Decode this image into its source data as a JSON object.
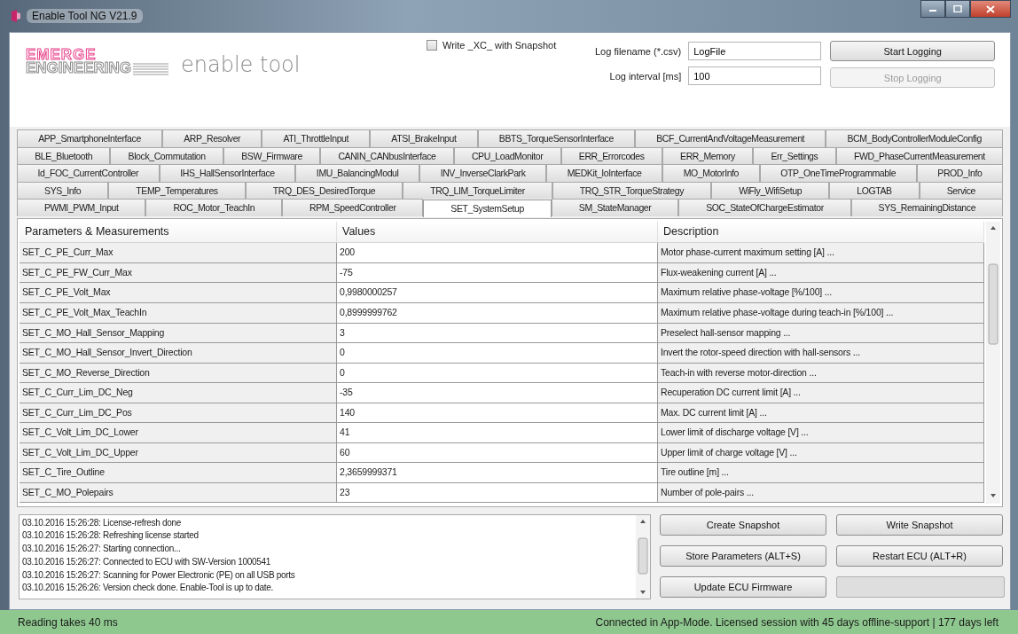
{
  "window": {
    "title": "Enable Tool NG V21.9"
  },
  "logo": {
    "line_1": "EMERGE",
    "line_2": "ENGINEERING",
    "product": "enable tool"
  },
  "snapshot_option": {
    "label": "Write _XC_ with Snapshot",
    "checked": false
  },
  "log_settings": [
    {
      "label": "Log filename (*.csv)",
      "value": "LogFile"
    },
    {
      "label": "Log interval [ms]",
      "value": "100"
    }
  ],
  "logging_buttons": [
    {
      "label": "Start Logging",
      "disabled": false
    },
    {
      "label": "Stop Logging",
      "disabled": true
    }
  ],
  "tab_rows": [
    [
      {
        "label": "APP_SmartphoneInterface",
        "selected": false
      },
      {
        "label": "ARP_Resolver",
        "selected": false
      },
      {
        "label": "ATI_ThrottleInput",
        "selected": false
      },
      {
        "label": "ATSI_BrakeInput",
        "selected": false
      },
      {
        "label": "BBTS_TorqueSensorInterface",
        "selected": false
      },
      {
        "label": "BCF_CurrentAndVoltageMeasurement",
        "selected": false
      },
      {
        "label": "BCM_BodyControllerModuleConfig",
        "selected": false
      }
    ],
    [
      {
        "label": "BLE_Bluetooth",
        "selected": false
      },
      {
        "label": "Block_Commutation",
        "selected": false
      },
      {
        "label": "BSW_Firmware",
        "selected": false
      },
      {
        "label": "CANIN_CANbusInterface",
        "selected": false
      },
      {
        "label": "CPU_LoadMonitor",
        "selected": false
      },
      {
        "label": "ERR_Errorcodes",
        "selected": false
      },
      {
        "label": "ERR_Memory",
        "selected": false
      },
      {
        "label": "Err_Settings",
        "selected": false
      },
      {
        "label": "FWD_PhaseCurrentMeasurement",
        "selected": false
      }
    ],
    [
      {
        "label": "Id_FOC_CurrentController",
        "selected": false
      },
      {
        "label": "IHS_HallSensorInterface",
        "selected": false
      },
      {
        "label": "IMU_BalancingModul",
        "selected": false
      },
      {
        "label": "INV_InverseClarkPark",
        "selected": false
      },
      {
        "label": "MEDKit_IoInterface",
        "selected": false
      },
      {
        "label": "MO_MotorInfo",
        "selected": false
      },
      {
        "label": "OTP_OneTimeProgrammable",
        "selected": false
      },
      {
        "label": "PROD_Info",
        "selected": false
      }
    ],
    [
      {
        "label": "SYS_Info",
        "selected": false
      },
      {
        "label": "TEMP_Temperatures",
        "selected": false
      },
      {
        "label": "TRQ_DES_DesiredTorque",
        "selected": false
      },
      {
        "label": "TRQ_LIM_TorqueLimiter",
        "selected": false
      },
      {
        "label": "TRQ_STR_TorqueStrategy",
        "selected": false
      },
      {
        "label": "WiFly_WifiSetup",
        "selected": false
      },
      {
        "label": "LOGTAB",
        "selected": false
      },
      {
        "label": "Service",
        "selected": false
      }
    ],
    [
      {
        "label": "PWMI_PWM_Input",
        "selected": false
      },
      {
        "label": "ROC_Motor_TeachIn",
        "selected": false
      },
      {
        "label": "RPM_SpeedController",
        "selected": false
      },
      {
        "label": "SET_SystemSetup",
        "selected": true
      },
      {
        "label": "SM_StateManager",
        "selected": false
      },
      {
        "label": "SOC_StateOfChargeEstimator",
        "selected": false
      },
      {
        "label": "SYS_RemainingDistance",
        "selected": false
      }
    ]
  ],
  "table": {
    "columns": [
      "Parameters & Measurements",
      "Values",
      "Description"
    ],
    "rows": [
      [
        "SET_C_PE_Curr_Max",
        "200",
        "Motor phase-current maximum setting [A] ..."
      ],
      [
        "SET_C_PE_FW_Curr_Max",
        "-75",
        "Flux-weakening current [A] ..."
      ],
      [
        "SET_C_PE_Volt_Max",
        "0,9980000257",
        "Maximum relative phase-voltage [%/100] ..."
      ],
      [
        "SET_C_PE_Volt_Max_TeachIn",
        "0,8999999762",
        "Maximum relative phase-voltage during teach-in [%/100] ..."
      ],
      [
        "SET_C_MO_Hall_Sensor_Mapping",
        "3",
        "Preselect hall-sensor mapping ..."
      ],
      [
        "SET_C_MO_Hall_Sensor_Invert_Direction",
        "0",
        "Invert the rotor-speed direction with hall-sensors ..."
      ],
      [
        "SET_C_MO_Reverse_Direction",
        "0",
        "Teach-in with reverse motor-direction ..."
      ],
      [
        "SET_C_Curr_Lim_DC_Neg",
        "-35",
        "Recuperation DC current limit [A] ..."
      ],
      [
        "SET_C_Curr_Lim_DC_Pos",
        "140",
        "Max. DC current limit [A] ..."
      ],
      [
        "SET_C_Volt_Lim_DC_Lower",
        "41",
        "Lower limit of discharge voltage [V] ..."
      ],
      [
        "SET_C_Volt_Lim_DC_Upper",
        "60",
        "Upper limit of charge voltage [V] ..."
      ],
      [
        "SET_C_Tire_Outline",
        "2,3659999371",
        "Tire outline [m] ..."
      ],
      [
        "SET_C_MO_Polepairs",
        "23",
        "Number of pole-pairs ..."
      ]
    ]
  },
  "log": [
    "03.10.2016 15:26:28: License-refresh done",
    "03.10.2016 15:26:28: Refreshing license started",
    "03.10.2016 15:26:27: Starting connection...",
    "03.10.2016 15:26:27: Connected to ECU with SW-Version 1000541",
    "03.10.2016 15:26:27: Scanning for Power Electronic (PE) on all USB ports",
    "03.10.2016 15:26:26: Version check done. Enable-Tool is up to date."
  ],
  "action_buttons": [
    "Create Snapshot",
    "Write Snapshot",
    "Store Parameters (ALT+S)",
    "Restart ECU (ALT+R)",
    "Update ECU Firmware"
  ],
  "status_bar": {
    "left": "Reading takes 40 ms",
    "right": "Connected in App-Mode.  Licensed session with 45 days offline-support | 177 days left"
  }
}
